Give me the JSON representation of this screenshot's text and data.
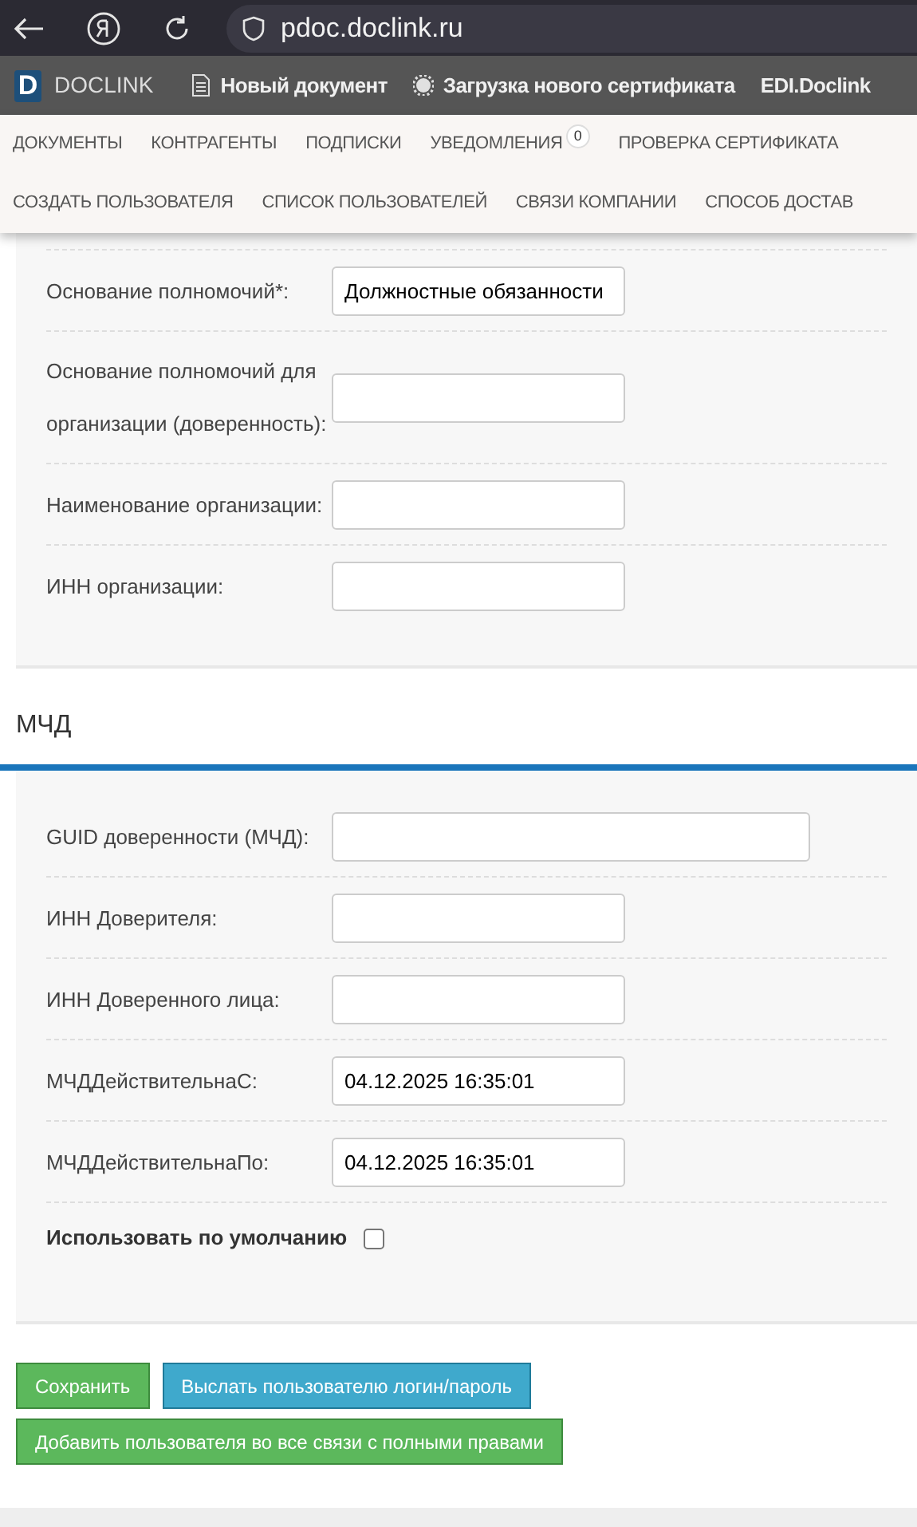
{
  "browser": {
    "url": "pdoc.doclink.ru"
  },
  "app_bar": {
    "brand": "DOCLINK",
    "logo_letter": "D",
    "items": [
      {
        "label": "Новый документ",
        "kind": "document"
      },
      {
        "label": "Загрузка нового сертификата",
        "kind": "gear"
      },
      {
        "label": "EDI.Doclink",
        "kind": "plain"
      }
    ]
  },
  "nav_rows": [
    [
      {
        "label": "ДОКУМЕНТЫ"
      },
      {
        "label": "КОНТРАГЕНТЫ"
      },
      {
        "label": "ПОДПИСКИ"
      },
      {
        "label": "УВЕДОМЛЕНИЯ",
        "badge": "0"
      },
      {
        "label": "ПРОВЕРКА СЕРТИФИКАТА"
      }
    ],
    [
      {
        "label": "СОЗДАТЬ ПОЛЬЗОВАТЕЛЯ"
      },
      {
        "label": "СПИСОК ПОЛЬЗОВАТЕЛЕЙ"
      },
      {
        "label": "СВЯЗИ КОМПАНИИ"
      },
      {
        "label": "СПОСОБ ДОСТАВ"
      }
    ]
  ],
  "sections": [
    {
      "fields": [
        {
          "label": "Основание полномочий*:",
          "kind": "input",
          "value": "Должностные обязанности"
        },
        {
          "label": "Основание полномочий для организации (доверенность):",
          "kind": "input"
        },
        {
          "label": "Наименование организации:",
          "kind": "input"
        },
        {
          "label": "ИНН организации:",
          "kind": "input"
        }
      ]
    },
    {
      "heading": "МЧД",
      "fields": [
        {
          "label": "GUID доверенности (МЧД):",
          "kind": "wide"
        },
        {
          "label": "ИНН Доверителя:",
          "kind": "input"
        },
        {
          "label": "ИНН Доверенного лица:",
          "kind": "input"
        },
        {
          "label": "МЧДДействительнаС:",
          "kind": "input",
          "value": "04.12.2025 16:35:01"
        },
        {
          "label": "МЧДДействительнаПо:",
          "kind": "input",
          "value": "04.12.2025 16:35:01"
        },
        {
          "label": "Использовать по умолчанию",
          "kind": "checkbox",
          "checked": false
        }
      ]
    }
  ],
  "buttons": [
    [
      {
        "label": "Сохранить",
        "kind": "success"
      },
      {
        "label": "Выслать пользователю логин/пароль",
        "kind": "info"
      }
    ],
    [
      {
        "label": "Добавить пользователя во все связи с полными правами",
        "kind": "success"
      }
    ]
  ]
}
